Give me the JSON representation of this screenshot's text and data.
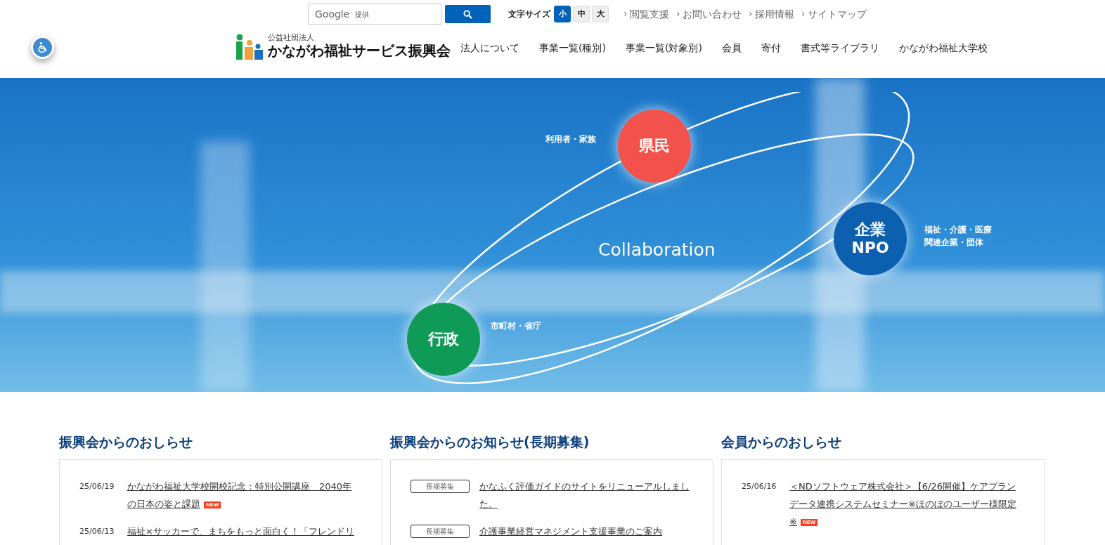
{
  "search": {
    "brand": "Google",
    "placeholder": "提供"
  },
  "font_size": {
    "label": "文字サイズ",
    "options": [
      {
        "label": "小",
        "selected": true
      },
      {
        "label": "中",
        "selected": false
      },
      {
        "label": "大",
        "selected": false
      }
    ]
  },
  "utility_links": [
    "閲覧支援",
    "お問い合わせ",
    "採用情報",
    "サイトマップ"
  ],
  "logo": {
    "subtitle": "公益社団法人",
    "name": "かながわ福祉サービス振興会"
  },
  "nav": [
    "法人について",
    "事業一覧(種別)",
    "事業一覧(対象別)",
    "会員",
    "寄付",
    "書式等ライブラリ",
    "かながわ福祉大学校"
  ],
  "hero": {
    "center": "Collaboration",
    "nodes": [
      {
        "kind": "top",
        "lines": [
          "県民"
        ],
        "caption": [
          "利用者・家族"
        ],
        "color": "#f2524b"
      },
      {
        "kind": "right",
        "lines": [
          "企業",
          "NPO"
        ],
        "caption": [
          "福祉・介護・医療",
          "関連企業・団体"
        ],
        "color": "#0d5fb0"
      },
      {
        "kind": "left",
        "lines": [
          "行政"
        ],
        "caption": [
          "市町村・省庁"
        ],
        "color": "#0f9a55"
      }
    ]
  },
  "sections": [
    {
      "title": "振興会からのおしらせ",
      "items": [
        {
          "date": "25/06/19",
          "text": "かながわ福祉大学校開校記念：特別公開講座　2040年の日本の姿と課題",
          "badge": "NEW"
        },
        {
          "date": "25/06/13",
          "text": "福祉×サッカーで、まちをもっと面白く！「フレンドリ"
        }
      ]
    },
    {
      "title": "振興会からのお知らせ(長期募集)",
      "items": [
        {
          "tag": "長期募集",
          "text": "かなふく評価ガイドのサイトをリニューアルしました。"
        },
        {
          "tag": "長期募集",
          "text": "介護事業経営マネジメント支援事業のご案内"
        }
      ]
    },
    {
      "title": "会員からのおしらせ",
      "items": [
        {
          "date": "25/06/16",
          "text": "＜NDソフトウェア株式会社＞【6/26開催】ケアプランデータ連携システムセミナー※ほのぼのユーザー様限定※",
          "badge": "NEW"
        }
      ]
    }
  ]
}
